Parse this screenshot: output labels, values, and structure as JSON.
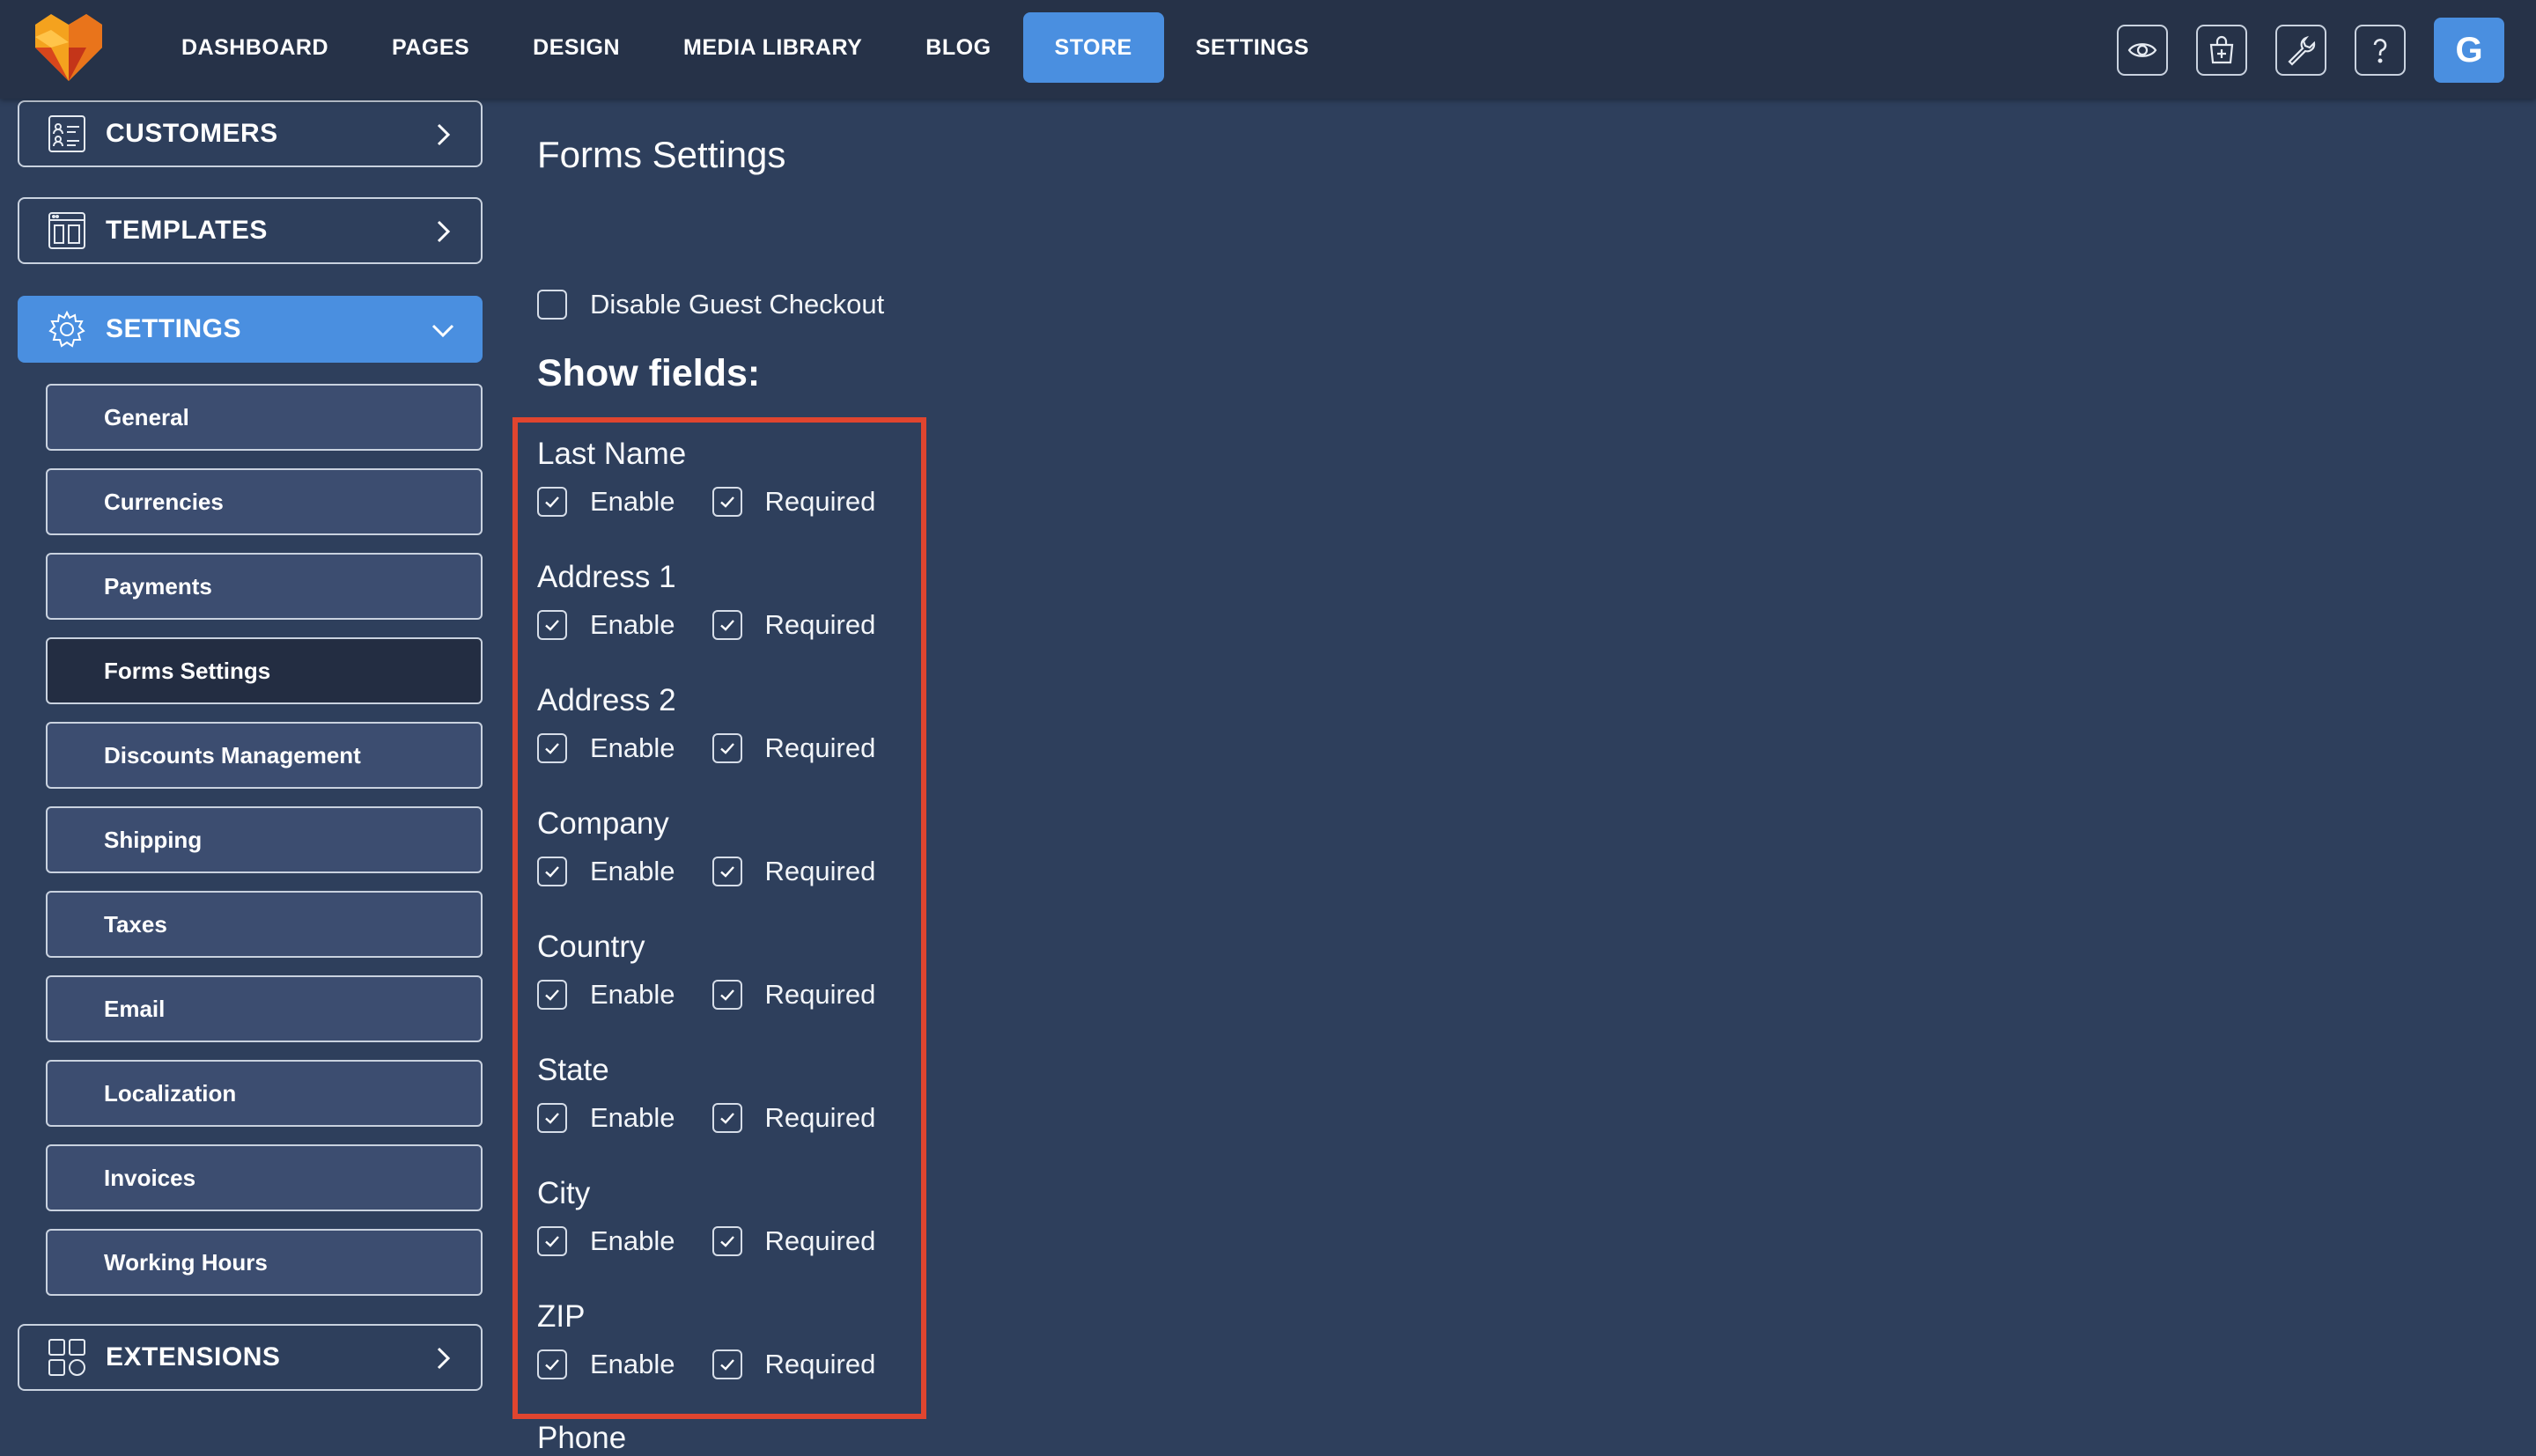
{
  "topbar": {
    "nav": [
      {
        "label": "DASHBOARD",
        "active": false
      },
      {
        "label": "PAGES",
        "active": false
      },
      {
        "label": "DESIGN",
        "active": false
      },
      {
        "label": "MEDIA LIBRARY",
        "active": false
      },
      {
        "label": "BLOG",
        "active": false
      },
      {
        "label": "STORE",
        "active": true
      },
      {
        "label": "SETTINGS",
        "active": false
      }
    ],
    "tools": [
      "eye-icon",
      "store-icon",
      "wrench-icon",
      "help-icon"
    ],
    "avatar_letter": "G",
    "accent": "#4a8fe0"
  },
  "sidebar": {
    "customers": "CUSTOMERS",
    "templates": "TEMPLATES",
    "settings": "SETTINGS",
    "extensions": "EXTENSIONS",
    "sub_items": [
      "General",
      "Currencies",
      "Payments",
      "Forms Settings",
      "Discounts Management",
      "Shipping",
      "Taxes",
      "Email",
      "Localization",
      "Invoices",
      "Working Hours"
    ],
    "active_sub": "Forms Settings"
  },
  "main": {
    "title": "Forms Settings",
    "guest_checkout_label": "Disable Guest Checkout",
    "guest_checkout_checked": false,
    "show_fields_heading": "Show fields:",
    "enable_label": "Enable",
    "required_label": "Required",
    "fields": [
      {
        "name": "Last Name",
        "enable": true,
        "required": true
      },
      {
        "name": "Address 1",
        "enable": true,
        "required": true
      },
      {
        "name": "Address 2",
        "enable": true,
        "required": true
      },
      {
        "name": "Company",
        "enable": true,
        "required": true
      },
      {
        "name": "Country",
        "enable": true,
        "required": true
      },
      {
        "name": "State",
        "enable": true,
        "required": true
      },
      {
        "name": "City",
        "enable": true,
        "required": true
      },
      {
        "name": "ZIP",
        "enable": true,
        "required": true
      }
    ],
    "next_field_partial": "Phone",
    "highlight_color": "#e0452f"
  }
}
